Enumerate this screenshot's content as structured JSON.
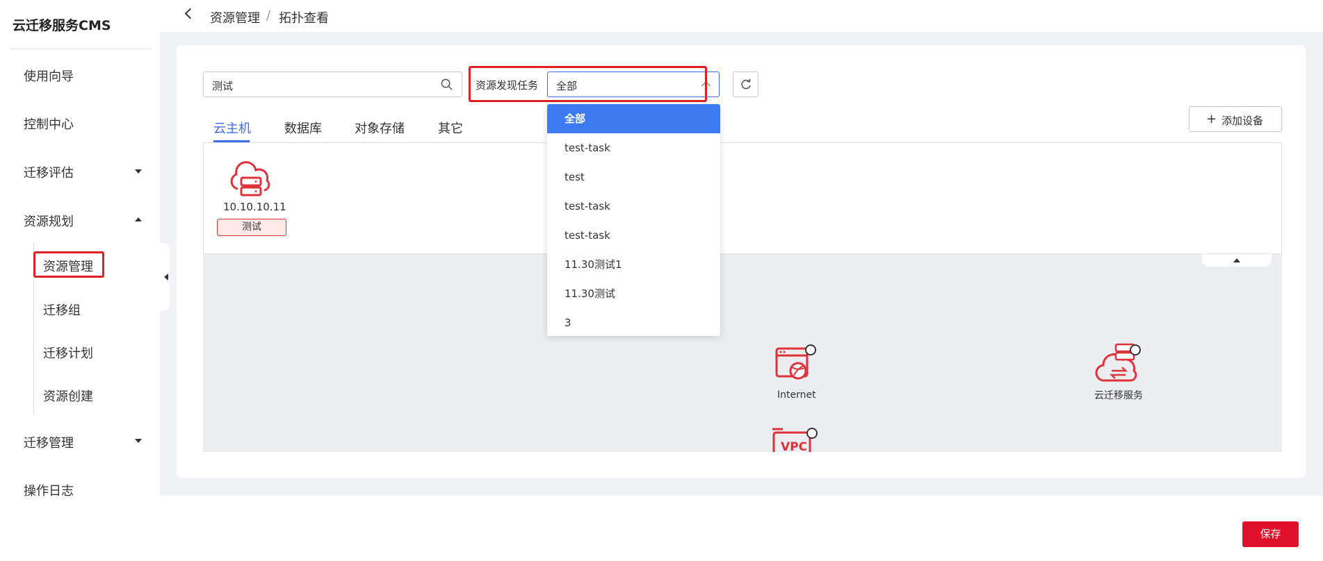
{
  "app": {
    "title": "云迁移服务CMS"
  },
  "sidebar": {
    "items": [
      {
        "label": "使用向导"
      },
      {
        "label": "控制中心"
      },
      {
        "label": "迁移评估"
      },
      {
        "label": "资源规划"
      },
      {
        "label": "迁移管理"
      },
      {
        "label": "操作日志"
      }
    ],
    "subitems": [
      {
        "label": "资源管理"
      },
      {
        "label": "迁移组"
      },
      {
        "label": "迁移计划"
      },
      {
        "label": "资源创建"
      }
    ]
  },
  "breadcrumb": {
    "parent": "资源管理",
    "separator": "/",
    "current": "拓扑查看"
  },
  "search": {
    "value": "测试"
  },
  "task_filter": {
    "label": "资源发现任务",
    "value": "全部"
  },
  "tabs": [
    {
      "label": "云主机"
    },
    {
      "label": "数据库"
    },
    {
      "label": "对象存储"
    },
    {
      "label": "其它"
    }
  ],
  "add_device": {
    "label": "添加设备"
  },
  "host": {
    "ip": "10.10.10.11",
    "tag": "测试"
  },
  "dropdown": {
    "options": [
      "全部",
      "test-task",
      "test",
      "test-task",
      "test-task",
      "11.30测试1",
      "11.30测试",
      "3"
    ]
  },
  "topology": {
    "internet": "Internet",
    "cms": "云迁移服务",
    "vpc": "VPC"
  },
  "footer": {
    "save_label": "保存"
  },
  "colors": {
    "accent": "#3b6ee8",
    "brand_red": "#e0102a",
    "highlight_box": "#e02020"
  },
  "icons": [
    "back-icon",
    "search-icon",
    "refresh-icon",
    "plus-icon",
    "caret-down-icon",
    "caret-up-icon",
    "chevron-up-icon",
    "cloud-server-icon",
    "internet-icon",
    "cloud-migration-icon",
    "vpc-icon"
  ]
}
